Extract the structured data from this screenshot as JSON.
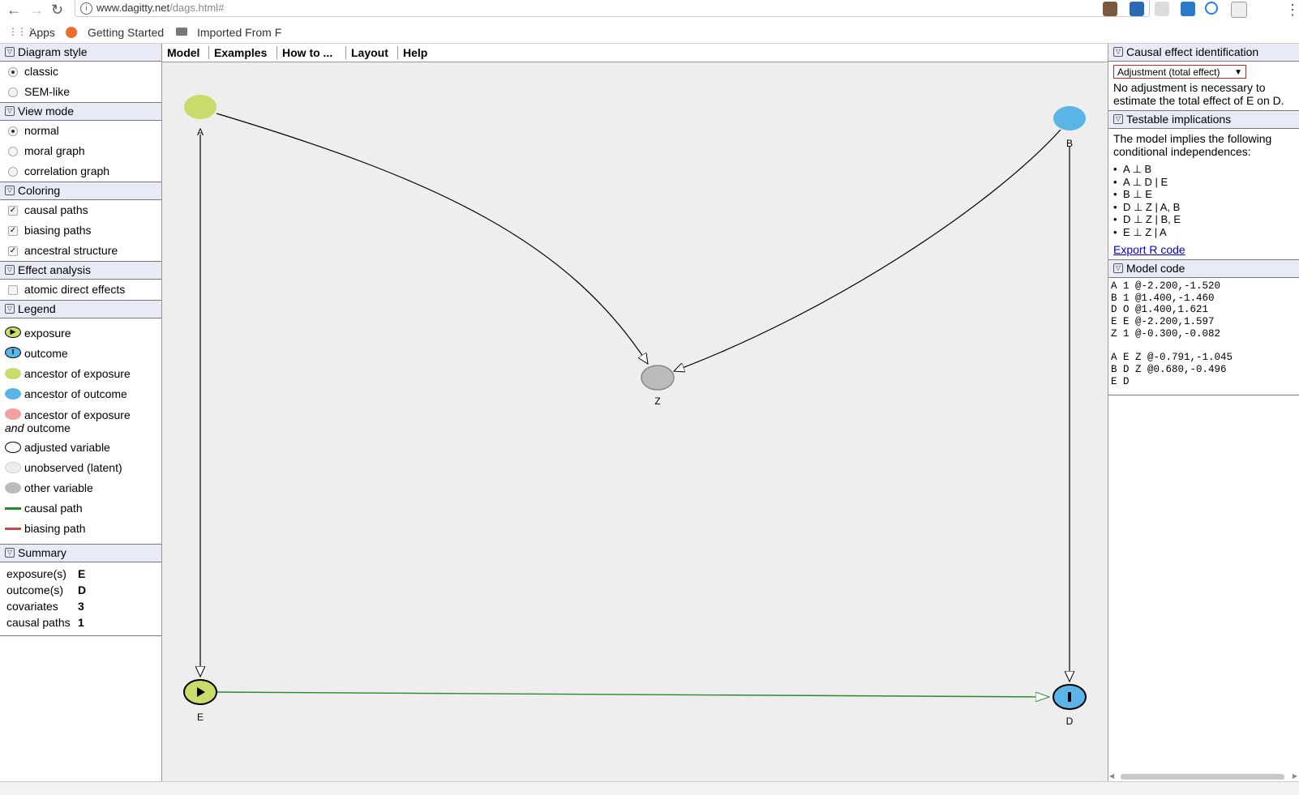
{
  "browser": {
    "url_host": "www.dagitty.net",
    "url_path": "/dags.html#",
    "bookmarks": [
      "Apps",
      "Getting Started",
      "Imported From F"
    ]
  },
  "menu": [
    "Model",
    "Examples",
    "How to ...",
    "Layout",
    "Help"
  ],
  "left": {
    "diagram_style": {
      "title": "Diagram style",
      "options": [
        {
          "label": "classic",
          "selected": true
        },
        {
          "label": "SEM-like",
          "selected": false
        }
      ]
    },
    "view_mode": {
      "title": "View mode",
      "options": [
        {
          "label": "normal",
          "selected": true
        },
        {
          "label": "moral graph",
          "selected": false
        },
        {
          "label": "correlation graph",
          "selected": false
        }
      ]
    },
    "coloring": {
      "title": "Coloring",
      "options": [
        {
          "label": "causal paths",
          "checked": true
        },
        {
          "label": "biasing paths",
          "checked": true
        },
        {
          "label": "ancestral structure",
          "checked": true
        }
      ]
    },
    "effect_analysis": {
      "title": "Effect analysis",
      "options": [
        {
          "label": "atomic direct effects",
          "checked": false
        }
      ]
    },
    "legend": {
      "title": "Legend",
      "items": {
        "exposure": "exposure",
        "outcome": "outcome",
        "ancestor_exposure": "ancestor of exposure",
        "ancestor_outcome": "ancestor of outcome",
        "ancestor_both_1": "ancestor of exposure",
        "ancestor_both_and": "and",
        "ancestor_both_2": " outcome",
        "adjusted": "adjusted variable",
        "unobserved": "unobserved (latent)",
        "other": "other variable",
        "causal_path": "causal path",
        "biasing_path": "biasing path"
      }
    },
    "summary": {
      "title": "Summary",
      "rows": [
        {
          "label": "exposure(s)",
          "value": "E"
        },
        {
          "label": "outcome(s)",
          "value": "D"
        },
        {
          "label": "covariates",
          "value": "3"
        },
        {
          "label": "causal paths",
          "value": "1"
        }
      ]
    }
  },
  "right": {
    "causal_effect": {
      "title": "Causal effect identification",
      "select_value": "Adjustment (total effect)",
      "message": "No adjustment is necessary to estimate the total effect of E on D."
    },
    "testable": {
      "title": "Testable implications",
      "intro": "The model implies the following conditional independences:",
      "items": [
        "A ⊥ B",
        "A ⊥ D | E",
        "B ⊥ E",
        "D ⊥ Z | A, B",
        "D ⊥ Z | B, E",
        "E ⊥ Z | A"
      ],
      "export_link": "Export R code"
    },
    "model_code": {
      "title": "Model code",
      "text": "A 1 @-2.200,-1.520\nB 1 @1.400,-1.460\nD O @1.400,1.621\nE E @-2.200,1.597\nZ 1 @-0.300,-0.082\n\nA E Z @-0.791,-1.045\nB D Z @0.680,-0.496\nE D"
    }
  },
  "graph": {
    "nodes": {
      "A": "A",
      "B": "B",
      "Z": "Z",
      "E": "E",
      "D": "D"
    },
    "colors": {
      "ancestor_exposure": "#c8dc6c",
      "ancestor_outcome": "#5ab4e6",
      "other": "#bbbbbb",
      "causal_path": "#2a8a2a",
      "biasing_path": "#c84848"
    }
  }
}
